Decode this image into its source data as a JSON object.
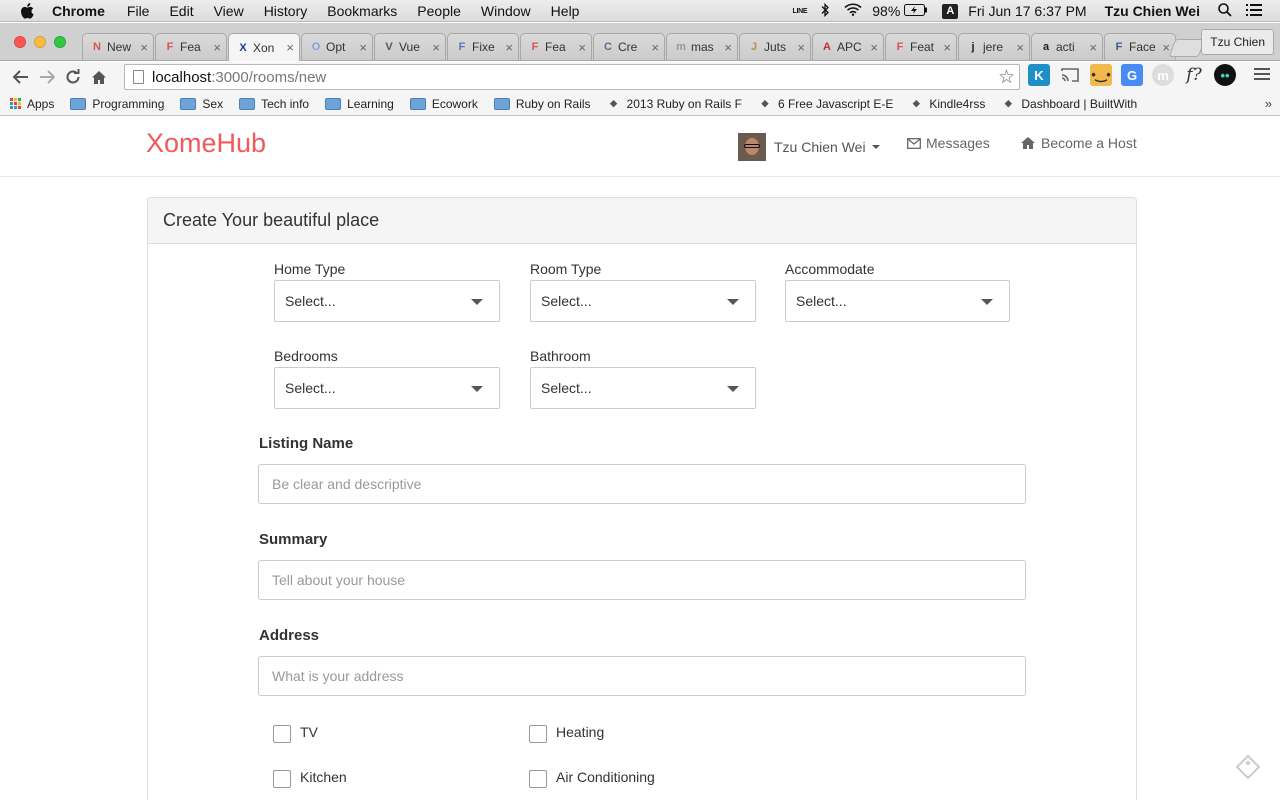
{
  "menubar": {
    "app": "Chrome",
    "items": [
      "File",
      "Edit",
      "View",
      "History",
      "Bookmarks",
      "People",
      "Window",
      "Help"
    ],
    "battery": "98%",
    "ime": "A",
    "datetime": "Fri Jun 17  6:37 PM",
    "user": "Tzu Chien Wei",
    "line_label": "LINE"
  },
  "tabs": [
    {
      "label": "New",
      "icon": "new-tab-favicon",
      "color": "#d9534f"
    },
    {
      "label": "Fea",
      "icon": "feature-favicon",
      "color": "#d9534f"
    },
    {
      "label": "Xon",
      "icon": "xomehub-favicon",
      "color": "#1f3a93"
    },
    {
      "label": "Opt",
      "icon": "options-favicon",
      "color": "#7fa6d9"
    },
    {
      "label": "Vue",
      "icon": "vue-favicon",
      "color": "#555555"
    },
    {
      "label": "Fixe",
      "icon": "grid-favicon",
      "color": "#4a7fb7"
    },
    {
      "label": "Fea",
      "icon": "feature-favicon",
      "color": "#d9534f"
    },
    {
      "label": "Cre",
      "icon": "c-favicon",
      "color": "#5b6b8c"
    },
    {
      "label": "mas",
      "icon": "doc-favicon",
      "color": "#999999"
    },
    {
      "label": "Juts",
      "icon": "image-favicon",
      "color": "#b5933a"
    },
    {
      "label": "APC",
      "icon": "apc-favicon",
      "color": "#c9302c"
    },
    {
      "label": "Feat",
      "icon": "feature-favicon",
      "color": "#d9534f"
    },
    {
      "label": "jere",
      "icon": "github-favicon",
      "color": "#222222"
    },
    {
      "label": "acti",
      "icon": "github-favicon",
      "color": "#222222"
    },
    {
      "label": "Face",
      "icon": "facebook-favicon",
      "color": "#3b5998"
    }
  ],
  "active_tab_index": 2,
  "profile_button": "Tzu Chien",
  "address": {
    "host": "localhost",
    "path": ":3000/rooms/new"
  },
  "bookmarks": [
    {
      "label": "Apps",
      "type": "apps"
    },
    {
      "label": "Programming",
      "type": "folder"
    },
    {
      "label": "Sex",
      "type": "folder"
    },
    {
      "label": "Tech info",
      "type": "folder"
    },
    {
      "label": "Learning",
      "type": "folder"
    },
    {
      "label": "Ecowork",
      "type": "folder"
    },
    {
      "label": "Ruby on Rails",
      "type": "folder"
    },
    {
      "label": "2013 Ruby on Rails F",
      "type": "link"
    },
    {
      "label": "6 Free Javascript E-E",
      "type": "link"
    },
    {
      "label": "Kindle4rss",
      "type": "link"
    },
    {
      "label": "Dashboard | BuiltWith",
      "type": "link"
    }
  ],
  "site": {
    "brand": "XomeHub",
    "brand_color": "#f05a5b",
    "user_name": "Tzu Chien Wei",
    "messages": "Messages",
    "become_host": "Become a Host"
  },
  "form": {
    "title": "Create Your beautiful place",
    "selects": [
      {
        "label": "Home Type",
        "value": "Select..."
      },
      {
        "label": "Room Type",
        "value": "Select..."
      },
      {
        "label": "Accommodate",
        "value": "Select..."
      },
      {
        "label": "Bedrooms",
        "value": "Select..."
      },
      {
        "label": "Bathroom",
        "value": "Select..."
      }
    ],
    "listing_name": {
      "label": "Listing Name",
      "placeholder": "Be clear and descriptive"
    },
    "summary": {
      "label": "Summary",
      "placeholder": "Tell about your house"
    },
    "address": {
      "label": "Address",
      "placeholder": "What is your address"
    },
    "amenities": [
      {
        "label": "TV",
        "checked": false
      },
      {
        "label": "Heating",
        "checked": false
      },
      {
        "label": "Kitchen",
        "checked": false
      },
      {
        "label": "Air Conditioning",
        "checked": false
      }
    ]
  }
}
